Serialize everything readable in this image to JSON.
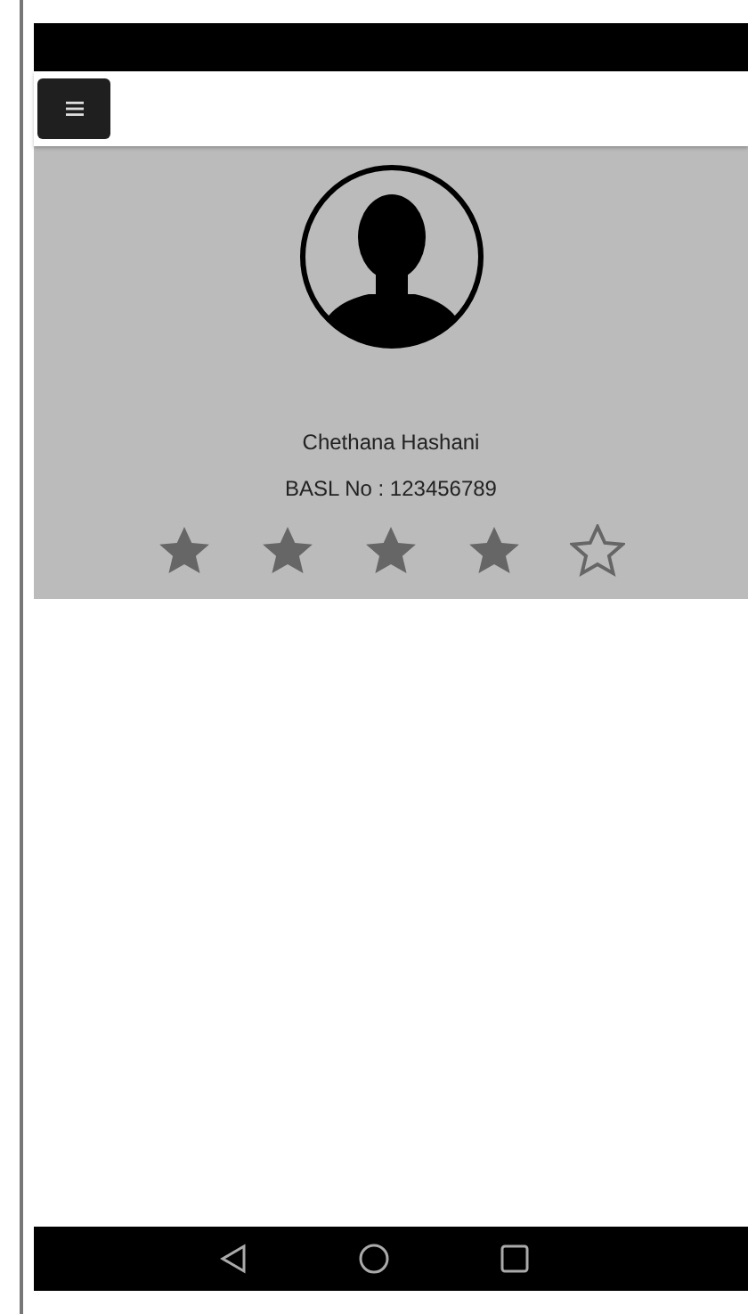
{
  "profile": {
    "name": "Chethana Hashani",
    "id_line": "BASL No : 123456789",
    "stars": 4
  }
}
